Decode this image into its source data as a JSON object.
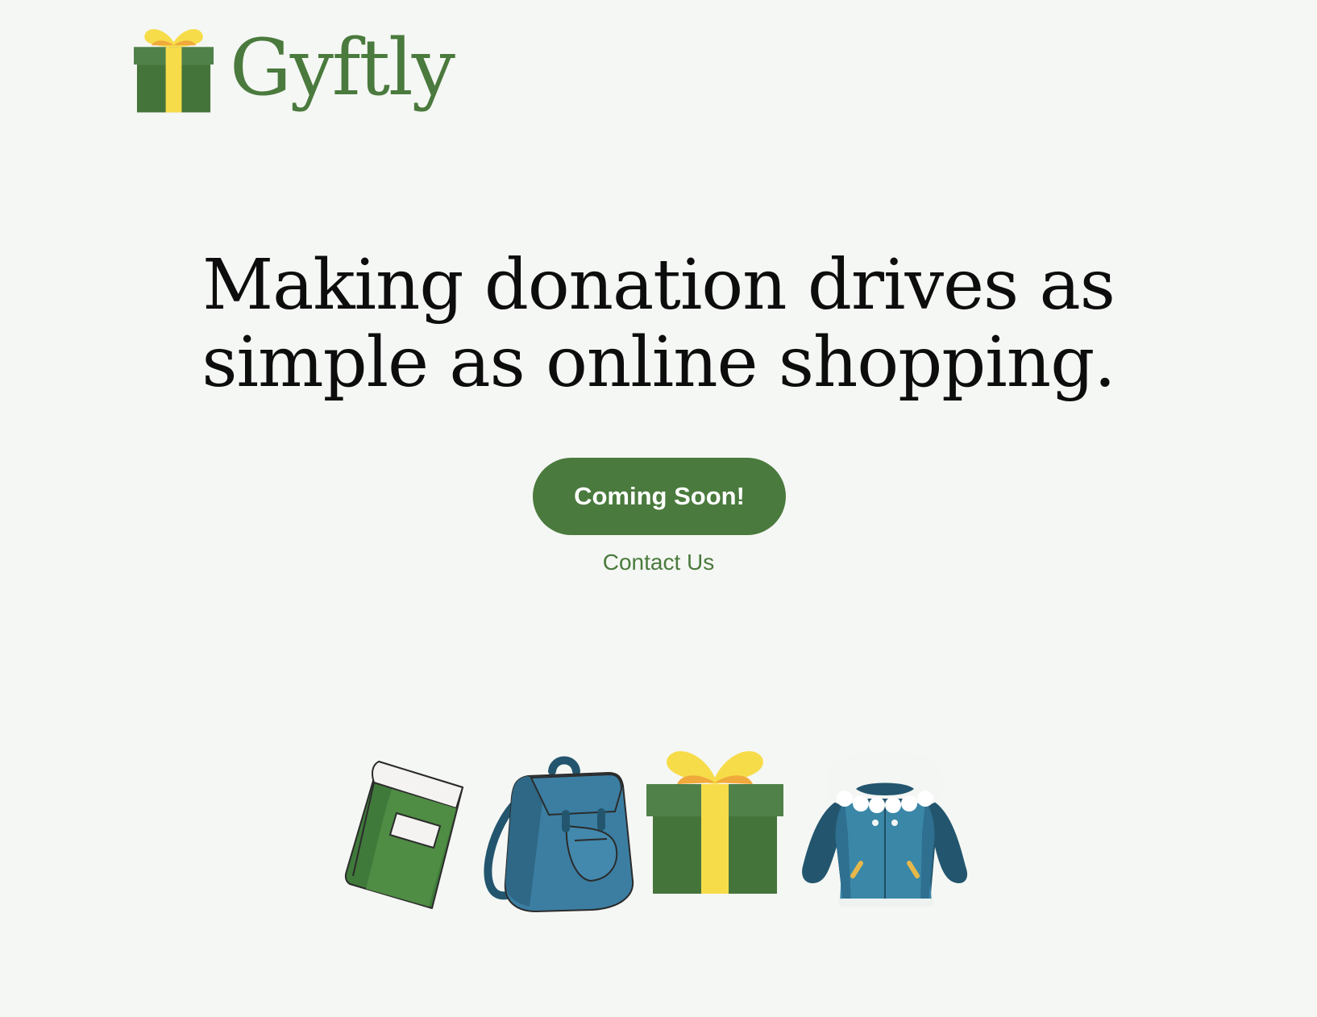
{
  "brand": {
    "name": "Gyftly",
    "logo_icon": "gift-box-icon",
    "color": "#4a7a3d",
    "accent_yellow": "#f7dc4a"
  },
  "hero": {
    "headline_line1": "Making donation drives as",
    "headline_line2": "simple as online shopping.",
    "cta_label": "Coming Soon!",
    "contact_link": "Contact Us"
  },
  "illustrations": [
    {
      "icon": "book-icon"
    },
    {
      "icon": "backpack-icon"
    },
    {
      "icon": "gift-box-icon"
    },
    {
      "icon": "winter-jacket-icon"
    }
  ]
}
